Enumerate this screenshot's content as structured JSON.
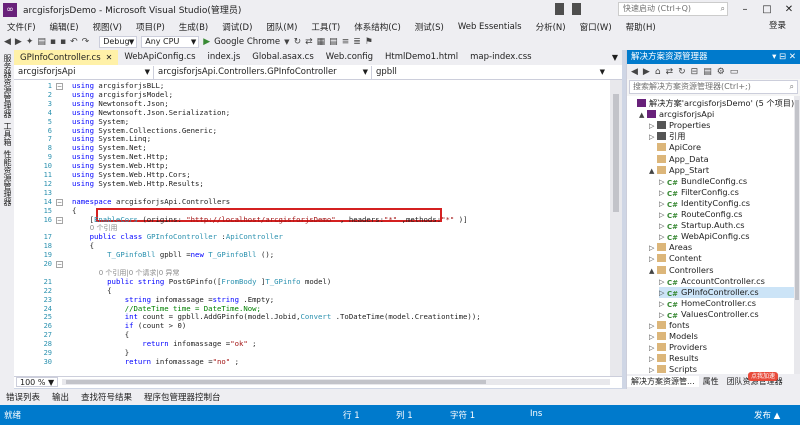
{
  "window": {
    "title": "arcgisforjsDemo - Microsoft Visual Studio(管理员)",
    "quick_launch_placeholder": "快速启动 (Ctrl+Q)",
    "login": "登录"
  },
  "menu": [
    "文件(F)",
    "编辑(E)",
    "视图(V)",
    "项目(P)",
    "生成(B)",
    "调试(D)",
    "团队(M)",
    "工具(T)",
    "体系结构(C)",
    "测试(S)",
    "Web Essentials",
    "分析(N)",
    "窗口(W)",
    "帮助(H)"
  ],
  "toolbar": {
    "config": "Debug",
    "platform": "Any CPU",
    "browser": "Google Chrome"
  },
  "left_strip": [
    "服务器资源管理器",
    "工具箱",
    "性能资源管理器"
  ],
  "tabs": [
    {
      "label": "GPInfoController.cs",
      "active": true
    },
    {
      "label": "WebApiConfig.cs",
      "active": false
    },
    {
      "label": "index.js",
      "active": false
    },
    {
      "label": "Global.asax.cs",
      "active": false
    },
    {
      "label": "Web.config",
      "active": false
    },
    {
      "label": "HtmlDemo1.html",
      "active": false
    },
    {
      "label": "map-index.css",
      "active": false
    }
  ],
  "nav": {
    "project": "arcgisforjsApi",
    "class": "arcgisforjsApi.Controllers.GPInfoController",
    "member": "gpbll"
  },
  "code": [
    {
      "n": "1",
      "t": [
        [
          "kw",
          "using"
        ],
        [
          "",
          "arcgisforjsBLL;"
        ]
      ]
    },
    {
      "n": "2",
      "t": [
        [
          "kw",
          "using"
        ],
        [
          "",
          "arcgisforjsModel;"
        ]
      ]
    },
    {
      "n": "3",
      "t": [
        [
          "kw",
          "using"
        ],
        [
          "",
          "Newtonsoft.Json;"
        ]
      ]
    },
    {
      "n": "4",
      "t": [
        [
          "kw",
          "using"
        ],
        [
          "",
          "Newtonsoft.Json.Serialization;"
        ]
      ]
    },
    {
      "n": "5",
      "t": [
        [
          "kw",
          "using"
        ],
        [
          "",
          "System;"
        ]
      ]
    },
    {
      "n": "6",
      "t": [
        [
          "kw",
          "using"
        ],
        [
          "",
          "System.Collections.Generic;"
        ]
      ]
    },
    {
      "n": "7",
      "t": [
        [
          "kw",
          "using"
        ],
        [
          "",
          "System.Linq;"
        ]
      ]
    },
    {
      "n": "8",
      "t": [
        [
          "kw",
          "using"
        ],
        [
          "",
          "System.Net;"
        ]
      ]
    },
    {
      "n": "9",
      "t": [
        [
          "kw",
          "using"
        ],
        [
          "",
          "System.Net.Http;"
        ]
      ]
    },
    {
      "n": "10",
      "t": [
        [
          "kw",
          "using"
        ],
        [
          "",
          "System.Web.Http;"
        ]
      ]
    },
    {
      "n": "11",
      "t": [
        [
          "kw",
          "using"
        ],
        [
          "",
          "System.Web.Http.Cors;"
        ]
      ]
    },
    {
      "n": "12",
      "t": [
        [
          "kw",
          "using"
        ],
        [
          "",
          "System.Web.Http.Results;"
        ]
      ]
    },
    {
      "n": "13",
      "t": []
    },
    {
      "n": "14",
      "t": [
        [
          "kw",
          "namespace"
        ],
        [
          "",
          "arcgisforjsApi.Controllers"
        ]
      ]
    },
    {
      "n": "15",
      "t": [
        [
          "",
          "{"
        ]
      ]
    },
    {
      "n": "16",
      "t": [
        [
          "",
          "    ["
        ],
        [
          "ty",
          "EnableCors"
        ],
        [
          "",
          "(origins: "
        ],
        [
          "str",
          "\"http://localhost/arcgisforjsDemo\""
        ],
        [
          "",
          ", headers:"
        ],
        [
          "str",
          "\"*\""
        ],
        [
          "",
          ",methods:"
        ],
        [
          "str",
          "\"*\""
        ],
        [
          "",
          ")]"
        ]
      ]
    },
    {
      "n": "",
      "lens": "        0 个引用"
    },
    {
      "n": "17",
      "t": [
        [
          "",
          "    "
        ],
        [
          "kw",
          "public class"
        ],
        [
          "",
          ""
        ],
        [
          "ty",
          "GPInfoController"
        ],
        [
          "",
          ":"
        ],
        [
          "ty",
          "ApiController"
        ]
      ]
    },
    {
      "n": "18",
      "t": [
        [
          "",
          "    {"
        ]
      ]
    },
    {
      "n": "19",
      "t": [
        [
          "",
          "        "
        ],
        [
          "ty",
          "T_GPinfoBll"
        ],
        [
          "",
          "gpbll ="
        ],
        [
          "kw",
          "new"
        ],
        [
          "",
          ""
        ],
        [
          "ty",
          "T_GPinfoBll"
        ],
        [
          "",
          "();"
        ]
      ]
    },
    {
      "n": "20",
      "t": []
    },
    {
      "n": "",
      "lens": "            0 个引用|0 个请求|0 异常"
    },
    {
      "n": "21",
      "t": [
        [
          "",
          "        "
        ],
        [
          "kw",
          "public string"
        ],
        [
          "",
          "PostGPinfo(["
        ],
        [
          "ty",
          "FromBody"
        ],
        [
          "",
          "]"
        ],
        [
          "ty",
          "T_GPinfo"
        ],
        [
          "",
          "model)"
        ]
      ]
    },
    {
      "n": "22",
      "t": [
        [
          "",
          "        {"
        ]
      ]
    },
    {
      "n": "23",
      "t": [
        [
          "",
          "            "
        ],
        [
          "kw",
          "string"
        ],
        [
          "",
          "infomassage ="
        ],
        [
          "kw",
          "string"
        ],
        [
          "",
          ".Empty;"
        ]
      ]
    },
    {
      "n": "24",
      "t": [
        [
          "cm",
          "            //DateTime time = DateTime.Now;"
        ]
      ]
    },
    {
      "n": "25",
      "t": [
        [
          "",
          "            "
        ],
        [
          "kw",
          "int"
        ],
        [
          "",
          "count = gpbll.AddGPinfo(model.Jobid,"
        ],
        [
          "ty",
          "Convert"
        ],
        [
          "",
          ".ToDateTime(model.Creationtime));"
        ]
      ]
    },
    {
      "n": "26",
      "t": [
        [
          "",
          "            "
        ],
        [
          "kw",
          "if"
        ],
        [
          "",
          "(count > 0)"
        ]
      ]
    },
    {
      "n": "27",
      "t": [
        [
          "",
          "            {"
        ]
      ]
    },
    {
      "n": "28",
      "t": [
        [
          "",
          "                "
        ],
        [
          "kw",
          "return"
        ],
        [
          "",
          "infomassage ="
        ],
        [
          "str",
          "\"ok\""
        ],
        [
          "",
          ";"
        ]
      ]
    },
    {
      "n": "29",
      "t": [
        [
          "",
          "            }"
        ]
      ]
    },
    {
      "n": "30",
      "t": [
        [
          "",
          "            "
        ],
        [
          "kw",
          "return"
        ],
        [
          "",
          "infomassage ="
        ],
        [
          "str",
          "\"no\""
        ],
        [
          "",
          ";"
        ]
      ]
    }
  ],
  "zoom": "100 %",
  "bottom_tabs": [
    "错误列表",
    "输出",
    "查找符号结果",
    "程序包管理器控制台"
  ],
  "status": {
    "state": "就绪",
    "line": "行 1",
    "col": "列 1",
    "char": "字符 1",
    "mode": "Ins",
    "publish": "发布 ▲"
  },
  "solution_explorer": {
    "title": "解决方案资源管理器",
    "search_placeholder": "搜索解决方案资源管理器(Ctrl+;)",
    "nodes": [
      {
        "label": "解决方案'arcgisforjsDemo' (5 个项目)",
        "indent": 0,
        "type": "sln",
        "arrow": ""
      },
      {
        "label": "arcgisforjsApi",
        "indent": 1,
        "type": "proj",
        "arrow": "▲"
      },
      {
        "label": "Properties",
        "indent": 2,
        "type": "prop",
        "arrow": "▷"
      },
      {
        "label": "引用",
        "indent": 2,
        "type": "prop",
        "arrow": "▷"
      },
      {
        "label": "ApiCore",
        "indent": 2,
        "type": "folder",
        "arrow": ""
      },
      {
        "label": "App_Data",
        "indent": 2,
        "type": "folder",
        "arrow": ""
      },
      {
        "label": "App_Start",
        "indent": 2,
        "type": "folder",
        "arrow": "▲"
      },
      {
        "label": "BundleConfig.cs",
        "indent": 3,
        "type": "cs",
        "arrow": "▷"
      },
      {
        "label": "FilterConfig.cs",
        "indent": 3,
        "type": "cs",
        "arrow": "▷"
      },
      {
        "label": "IdentityConfig.cs",
        "indent": 3,
        "type": "cs",
        "arrow": "▷"
      },
      {
        "label": "RouteConfig.cs",
        "indent": 3,
        "type": "cs",
        "arrow": "▷"
      },
      {
        "label": "Startup.Auth.cs",
        "indent": 3,
        "type": "cs",
        "arrow": "▷"
      },
      {
        "label": "WebApiConfig.cs",
        "indent": 3,
        "type": "cs",
        "arrow": "▷"
      },
      {
        "label": "Areas",
        "indent": 2,
        "type": "folder",
        "arrow": "▷"
      },
      {
        "label": "Content",
        "indent": 2,
        "type": "folder",
        "arrow": "▷"
      },
      {
        "label": "Controllers",
        "indent": 2,
        "type": "folder",
        "arrow": "▲"
      },
      {
        "label": "AccountController.cs",
        "indent": 3,
        "type": "cs",
        "arrow": "▷"
      },
      {
        "label": "GPInfoController.cs",
        "indent": 3,
        "type": "cs",
        "arrow": "▷",
        "selected": true
      },
      {
        "label": "HomeController.cs",
        "indent": 3,
        "type": "cs",
        "arrow": "▷"
      },
      {
        "label": "ValuesController.cs",
        "indent": 3,
        "type": "cs",
        "arrow": "▷"
      },
      {
        "label": "fonts",
        "indent": 2,
        "type": "folder",
        "arrow": "▷"
      },
      {
        "label": "Models",
        "indent": 2,
        "type": "folder",
        "arrow": "▷"
      },
      {
        "label": "Providers",
        "indent": 2,
        "type": "folder",
        "arrow": "▷"
      },
      {
        "label": "Results",
        "indent": 2,
        "type": "folder",
        "arrow": "▷"
      },
      {
        "label": "Scripts",
        "indent": 2,
        "type": "folder",
        "arrow": "▷"
      }
    ],
    "bottom_tabs": [
      "解决方案资源管...",
      "属性",
      "团队资源管理器"
    ],
    "badge": "点我加速"
  },
  "colors": {
    "accent": "#007acc",
    "active_tab": "#fff1a8",
    "highlight_box": "#d42020"
  }
}
